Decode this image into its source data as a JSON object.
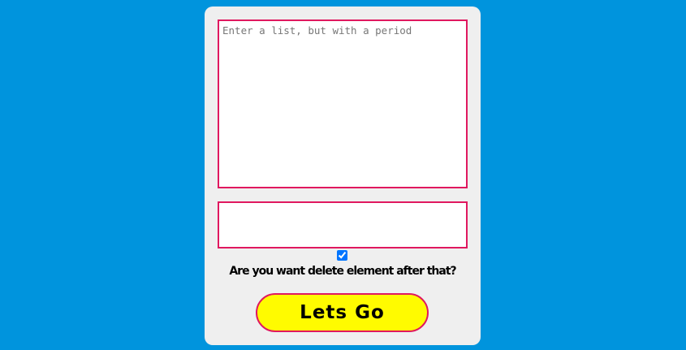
{
  "form": {
    "list_input": {
      "value": "",
      "placeholder": "Enter a list, but with a period"
    },
    "result_value": "",
    "delete_option": {
      "checked": true,
      "label": "Are you want delete element after that?"
    },
    "submit_label": "Lets Go"
  },
  "colors": {
    "background": "#0094dd",
    "card": "#efefef",
    "border_accent": "#e0185f",
    "button_fill": "#fffb00",
    "checkbox": "#0075ff"
  }
}
